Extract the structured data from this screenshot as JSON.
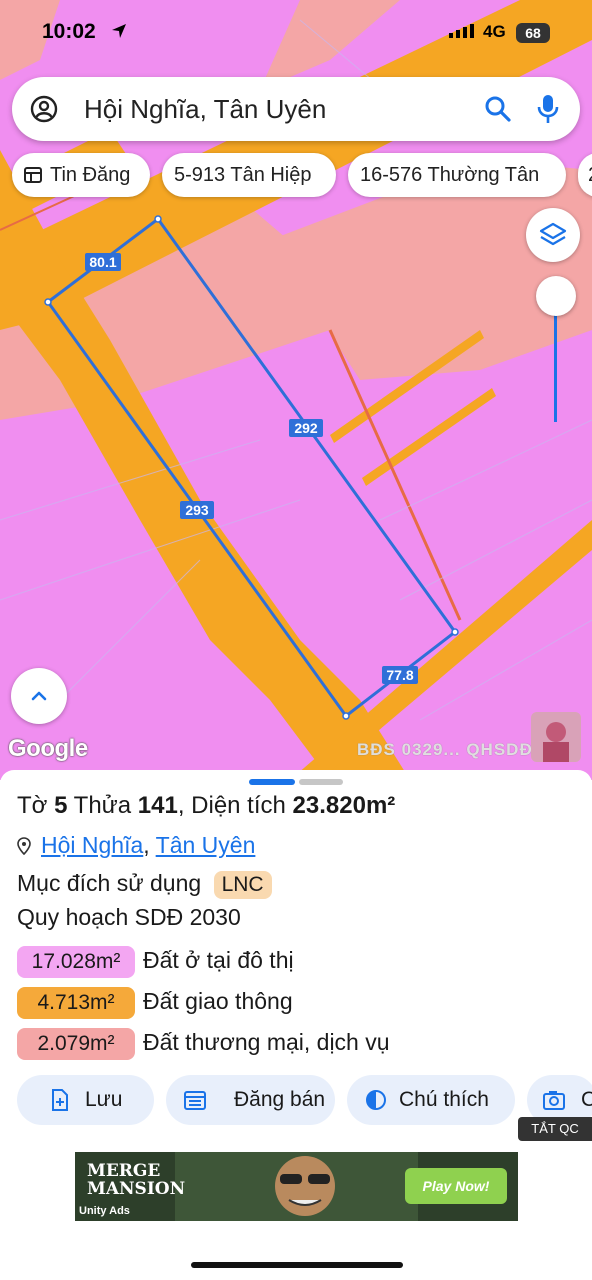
{
  "status_bar": {
    "time": "10:02",
    "network": "4G",
    "battery": "68"
  },
  "search": {
    "query": "Hội Nghĩa, Tân Uyên"
  },
  "chips": [
    {
      "label": "Tin Đăng"
    },
    {
      "label": "5-913 Tân Hiệp"
    },
    {
      "label": "16-576 Thường Tân"
    },
    {
      "label": "2"
    }
  ],
  "map": {
    "labels": {
      "top": "80.1",
      "right": "292",
      "left": "293",
      "bottom": "77.8"
    },
    "brand": "Google",
    "watermark": "BĐS 0329... QHSDĐ 2030",
    "colors": {
      "residential": "#f08ef0",
      "road": "#f5a623",
      "commercial": "#f4a6a6",
      "boundary": "#2f6fd8"
    }
  },
  "sheet": {
    "title_prefix": "Tờ",
    "sheet_no": "5",
    "plot_prefix": "Thửa",
    "plot_no": "141",
    "area_prefix": ", Diện tích",
    "area": "23.820m²",
    "location_1": "Hội Nghĩa",
    "location_sep": ",",
    "location_2": "Tân Uyên",
    "purpose_label": "Mục đích sử dụng",
    "purpose_tag": "LNC",
    "plan_label": "Quy hoạch SDĐ 2030",
    "zones": [
      {
        "area": "17.028m²",
        "label": "Đất ở tại đô thị",
        "color": "#f3a6f2"
      },
      {
        "area": "4.713m²",
        "label": "Đất giao thông",
        "color": "#f5a93a"
      },
      {
        "area": "2.079m²",
        "label": "Đất thương mại, dịch vụ",
        "color": "#f4a6a6"
      }
    ],
    "actions": [
      {
        "label": "Lưu",
        "icon": "save-file-icon"
      },
      {
        "label": "Đăng bán",
        "icon": "calendar-list-icon"
      },
      {
        "label": "Chú thích",
        "icon": "contrast-icon"
      },
      {
        "label": "C",
        "icon": "camera-icon"
      }
    ]
  },
  "ad": {
    "close_label": "TẮT QC",
    "title": "MERGE MANSION",
    "cta": "Play Now!",
    "provider": "Unity Ads"
  }
}
